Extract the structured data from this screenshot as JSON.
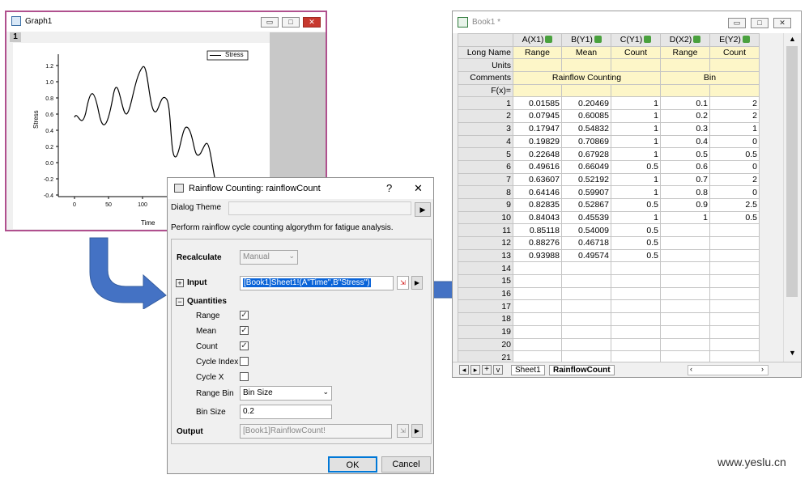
{
  "graph_window": {
    "title": "Graph1",
    "layer_label": "1",
    "legend_label": "Stress",
    "x_axis_label": "Time",
    "y_axis_label": "Stress",
    "x_ticks": [
      "0",
      "50",
      "100"
    ],
    "y_ticks": [
      "1.2",
      "1.0",
      "0.8",
      "0.6",
      "0.4",
      "0.2",
      "0.0",
      "-0.2",
      "-0.4"
    ]
  },
  "workbook": {
    "title": "Book1 *",
    "columns": [
      "A(X1)",
      "B(Y1)",
      "C(Y1)",
      "D(X2)",
      "E(Y2)"
    ],
    "long_names": [
      "Range",
      "Mean",
      "Count",
      "Range",
      "Count"
    ],
    "comments_group1": "Rainflow Counting",
    "comments_group2": "Bin",
    "row_labels": {
      "long_name": "Long Name",
      "units": "Units",
      "comments": "Comments",
      "fx": "F(x)="
    },
    "rows": [
      [
        "1",
        "0.01585",
        "0.20469",
        "1",
        "0.1",
        "2"
      ],
      [
        "2",
        "0.07945",
        "0.60085",
        "1",
        "0.2",
        "2"
      ],
      [
        "3",
        "0.17947",
        "0.54832",
        "1",
        "0.3",
        "1"
      ],
      [
        "4",
        "0.19829",
        "0.70869",
        "1",
        "0.4",
        "0"
      ],
      [
        "5",
        "0.22648",
        "0.67928",
        "1",
        "0.5",
        "0.5"
      ],
      [
        "6",
        "0.49616",
        "0.66049",
        "0.5",
        "0.6",
        "0"
      ],
      [
        "7",
        "0.63607",
        "0.52192",
        "1",
        "0.7",
        "2"
      ],
      [
        "8",
        "0.64146",
        "0.59907",
        "1",
        "0.8",
        "0"
      ],
      [
        "9",
        "0.82835",
        "0.52867",
        "0.5",
        "0.9",
        "2.5"
      ],
      [
        "10",
        "0.84043",
        "0.45539",
        "1",
        "1",
        "0.5"
      ],
      [
        "11",
        "0.85118",
        "0.54009",
        "0.5",
        "",
        ""
      ],
      [
        "12",
        "0.88276",
        "0.46718",
        "0.5",
        "",
        ""
      ],
      [
        "13",
        "0.93988",
        "0.49574",
        "0.5",
        "",
        ""
      ],
      [
        "14",
        "",
        "",
        "",
        "",
        ""
      ],
      [
        "15",
        "",
        "",
        "",
        "",
        ""
      ],
      [
        "16",
        "",
        "",
        "",
        "",
        ""
      ],
      [
        "17",
        "",
        "",
        "",
        "",
        ""
      ],
      [
        "18",
        "",
        "",
        "",
        "",
        ""
      ],
      [
        "19",
        "",
        "",
        "",
        "",
        ""
      ],
      [
        "20",
        "",
        "",
        "",
        "",
        ""
      ],
      [
        "21",
        "",
        "",
        "",
        "",
        ""
      ]
    ],
    "sheet_tabs": [
      "Sheet1",
      "RainflowCount"
    ],
    "active_tab": "RainflowCount"
  },
  "dialog": {
    "title": "Rainflow Counting: rainflowCount",
    "help_label": "?",
    "close_label": "✕",
    "theme_label": "Dialog Theme",
    "description": "Perform rainflow cycle counting algorythm for fatigue analysis.",
    "recalculate_label": "Recalculate",
    "recalculate_value": "Manual",
    "input_label": "Input",
    "input_value": "[Book1]Sheet1!(A\"Time\",B\"Stress\")",
    "quantities_label": "Quantities",
    "range_label": "Range",
    "mean_label": "Mean",
    "count_label": "Count",
    "cycle_index_label": "Cycle Index",
    "cycle_x_label": "Cycle X",
    "range_bin_label": "Range Bin",
    "range_bin_value": "Bin Size",
    "bin_size_label": "Bin Size",
    "bin_size_value": "0.2",
    "output_label": "Output",
    "output_value": "[Book1]RainflowCount!",
    "ok_label": "OK",
    "cancel_label": "Cancel",
    "checked": {
      "range": true,
      "mean": true,
      "count": true,
      "cycle_index": false,
      "cycle_x": false
    }
  },
  "watermark": "www.yeslu.cn",
  "colors": {
    "graph_border": "#b0508e",
    "arrow_blue": "#4472c4",
    "meta_yellow": "#fdf6c8",
    "input_highlight": "#0a64d8"
  }
}
